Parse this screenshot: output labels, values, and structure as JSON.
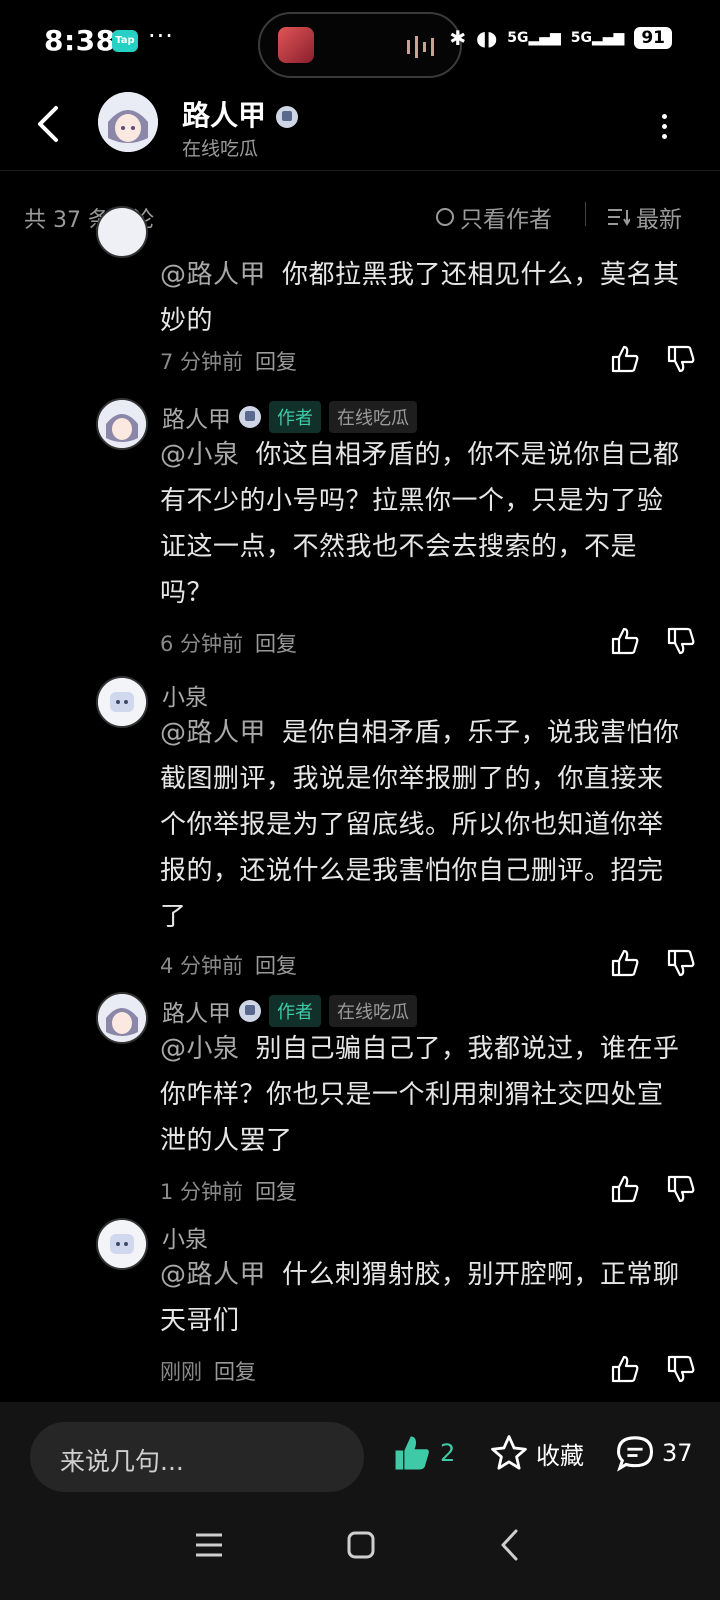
{
  "status_bar": {
    "time": "8:38",
    "app_badge": "Tap",
    "battery": "91",
    "network": "5G"
  },
  "header": {
    "name": "路人甲",
    "subtitle": "在线吃瓜"
  },
  "filter": {
    "count": "共 37 条评论",
    "author_only": "只看作者",
    "sort": "最新"
  },
  "comments": [
    {
      "name": "",
      "mention": "@路人甲",
      "text": "你都拉黑我了还相见什么，莫名其妙的",
      "time": "7 分钟前",
      "reply": "回复"
    },
    {
      "name": "路人甲",
      "author_badge": "作者",
      "tag": "在线吃瓜",
      "mention": "@小泉",
      "text": "你这自相矛盾的，你不是说你自己都有不少的小号吗？拉黑你一个，只是为了验证这一点，不然我也不会去搜索的，不是吗？",
      "time": "6 分钟前",
      "reply": "回复"
    },
    {
      "name": "小泉",
      "mention": "@路人甲",
      "text": "是你自相矛盾，乐子，说我害怕你截图删评，我说是你举报删了的，你直接来个你举报是为了留底线。所以你也知道你举报的，还说什么是我害怕你自己删评。招完了",
      "time": "4 分钟前",
      "reply": "回复"
    },
    {
      "name": "路人甲",
      "author_badge": "作者",
      "tag": "在线吃瓜",
      "mention": "@小泉",
      "text": "别自己骗自己了，我都说过，谁在乎你咋样？你也只是一个利用刺猬社交四处宣泄的人罢了",
      "time": "1 分钟前",
      "reply": "回复"
    },
    {
      "name": "小泉",
      "mention": "@路人甲",
      "text": "什么刺猬射胶，别开腔啊，正常聊天哥们",
      "time": "刚刚",
      "reply": "回复"
    }
  ],
  "bottom_bar": {
    "input_placeholder": "来说几句...",
    "like_count": "2",
    "favorite_label": "收藏",
    "comment_count": "37"
  },
  "colors": {
    "accent": "#3ec9a7",
    "background": "#000000",
    "muted": "#8a8a8a"
  }
}
